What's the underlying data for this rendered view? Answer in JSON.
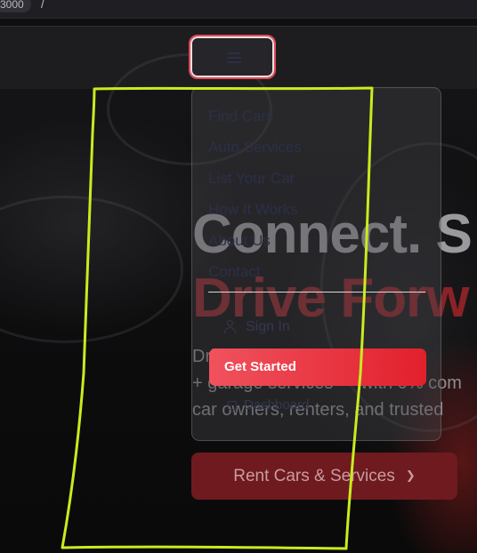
{
  "browser": {
    "url_port": "3000",
    "url_path": "/"
  },
  "header": {
    "menu_icon": "hamburger-menu-icon"
  },
  "hero": {
    "title_line1": "Connect. S",
    "title_line2": "Drive Forw",
    "description_lines": [
      "Drive                      tive e",
      "+ garage services — with 0% com",
      "car owners, renters, and trusted"
    ],
    "rent_button_label": "Rent Cars & Services"
  },
  "menu": {
    "items": [
      {
        "label": "Find Cars"
      },
      {
        "label": "Auto Services"
      },
      {
        "label": "List Your Car"
      },
      {
        "label": "How It Works"
      },
      {
        "label": "About Us"
      },
      {
        "label": "Contact"
      }
    ],
    "sign_in_label": "Sign In",
    "get_started_label": "Get Started",
    "dashboard_label": "Dashboard"
  },
  "colors": {
    "accent": "#e2202c",
    "annotation": "#c8ec1e"
  }
}
